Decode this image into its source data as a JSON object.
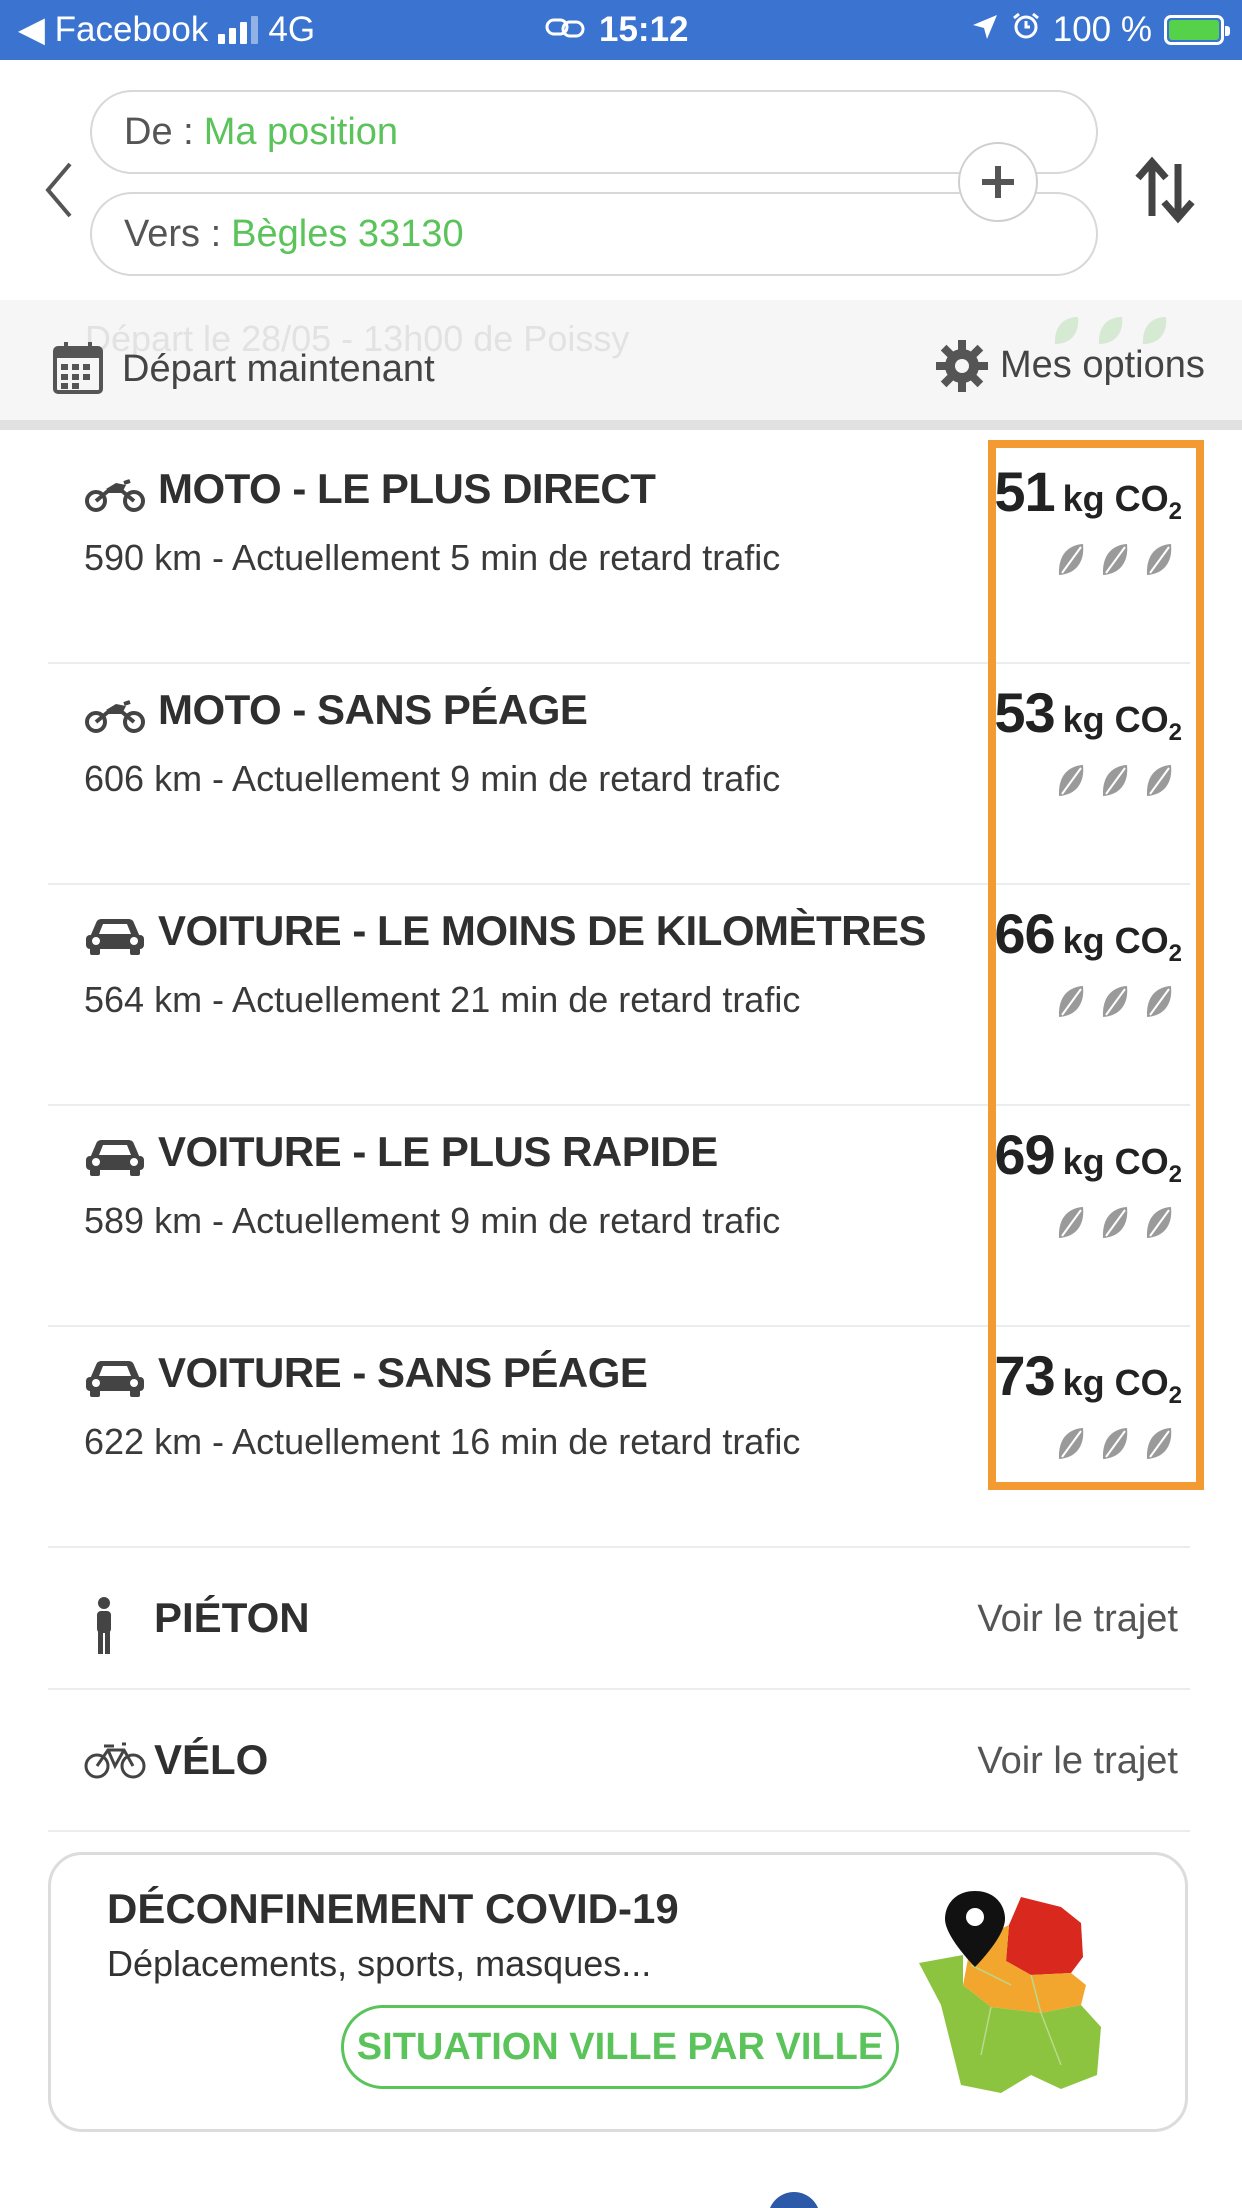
{
  "status_bar": {
    "back_app": "◀ Facebook",
    "network": "4G",
    "time": "15:12",
    "battery": "100 %"
  },
  "search": {
    "from_label": "De :",
    "from_value": "Ma position",
    "to_label": "Vers :",
    "to_value": "Bègles 33130"
  },
  "options_bar": {
    "ghost_text": "Départ le 28/05 - 13h00 de Poissy",
    "departure": "Départ maintenant",
    "options": "Mes options"
  },
  "routes": [
    {
      "icon": "motorcycle-icon",
      "title": "MOTO - LE PLUS DIRECT",
      "subtitle": "590 km - Actuellement 5 min de retard trafic",
      "co2_value": "51",
      "co2_unit": "kg CO",
      "co2_sub": "2"
    },
    {
      "icon": "motorcycle-icon",
      "title": "MOTO - SANS PÉAGE",
      "subtitle": "606 km - Actuellement 9 min de retard trafic",
      "co2_value": "53",
      "co2_unit": "kg CO",
      "co2_sub": "2"
    },
    {
      "icon": "car-icon",
      "title": "VOITURE - LE MOINS DE KILOMÈTRES",
      "subtitle": "564 km - Actuellement 21 min de retard trafic",
      "co2_value": "66",
      "co2_unit": "kg CO",
      "co2_sub": "2"
    },
    {
      "icon": "car-icon",
      "title": "VOITURE - LE PLUS RAPIDE",
      "subtitle": "589 km - Actuellement 9 min de retard trafic",
      "co2_value": "69",
      "co2_unit": "kg CO",
      "co2_sub": "2"
    },
    {
      "icon": "car-icon",
      "title": "VOITURE - SANS PÉAGE",
      "subtitle": "622 km - Actuellement 16 min de retard trafic",
      "co2_value": "73",
      "co2_unit": "kg CO",
      "co2_sub": "2"
    }
  ],
  "simple_routes": [
    {
      "icon": "pedestrian-icon",
      "title": "PIÉTON",
      "link": "Voir le trajet"
    },
    {
      "icon": "bicycle-icon",
      "title": "VÉLO",
      "link": "Voir le trajet"
    }
  ],
  "covid_card": {
    "title": "DÉCONFINEMENT COVID-19",
    "subtitle": "Déplacements, sports, masques...",
    "button": "SITUATION VILLE PAR VILLE"
  },
  "colors": {
    "status_bar": "#3a74d0",
    "accent_green": "#5ac35a",
    "highlight_orange": "#f39a33",
    "leaf_gray": "#9a9a9a",
    "map_red": "#d9281e",
    "map_orange": "#f2a62d",
    "map_green": "#8cc43f"
  }
}
